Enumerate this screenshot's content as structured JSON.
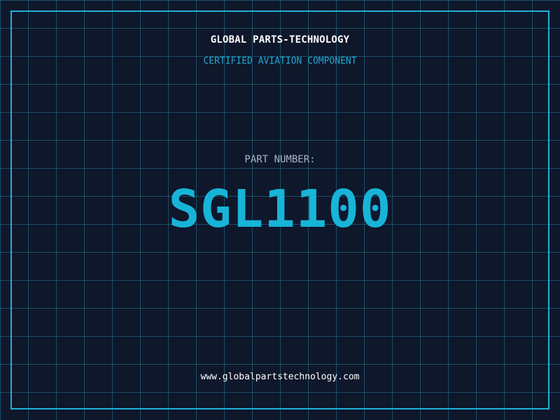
{
  "header": {
    "company": "GLOBAL PARTS-TECHNOLOGY",
    "subtitle": "CERTIFIED AVIATION COMPONENT"
  },
  "part": {
    "label": "PART NUMBER:",
    "number": "SGL1100"
  },
  "footer": {
    "website": "www.globalpartstechnology.com"
  },
  "colors": {
    "background": "#0f172b",
    "grid": "#2daac8",
    "accent": "#18b4d8",
    "text": "#ffffff",
    "muted": "#a9b4c6"
  }
}
